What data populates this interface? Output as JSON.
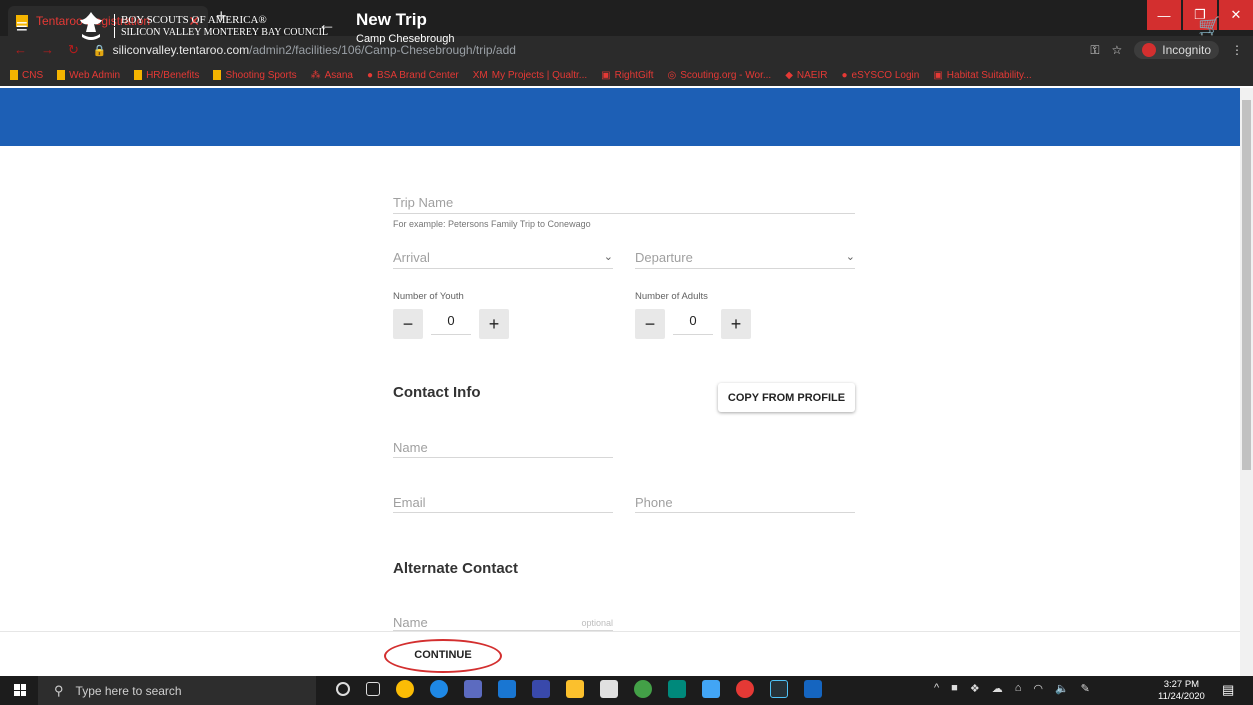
{
  "browser": {
    "tab_title": "Tentaroo Registration",
    "url_host": "siliconvalley.tentaroo.com",
    "url_path": "/admin2/facilities/106/Camp-Chesebrough/trip/add",
    "incognito_label": "Incognito",
    "bookmarks": [
      "CNS",
      "Web Admin",
      "HR/Benefits",
      "Shooting Sports",
      "Asana",
      "BSA Brand Center",
      "My Projects | Qualtr...",
      "RightGift",
      "Scouting.org - Wor...",
      "NAEIR",
      "eSYSCO Login",
      "Habitat Suitability..."
    ]
  },
  "header": {
    "org_line1": "BOY SCOUTS OF AMERICA®",
    "org_line2": "SILICON VALLEY MONTEREY BAY COUNCIL",
    "title": "New Trip",
    "subtitle": "Camp Chesebrough",
    "brand_color": "#1d5fb5"
  },
  "form": {
    "trip_name_placeholder": "Trip Name",
    "trip_name_hint": "For example: Petersons Family Trip to Conewago",
    "arrival_placeholder": "Arrival",
    "departure_placeholder": "Departure",
    "youth_label": "Number of Youth",
    "youth_value": "0",
    "adults_label": "Number of Adults",
    "adults_value": "0",
    "contact_heading": "Contact Info",
    "copy_button": "COPY FROM PROFILE",
    "name_placeholder": "Name",
    "email_placeholder": "Email",
    "phone_placeholder": "Phone",
    "alt_heading": "Alternate Contact",
    "alt_name_placeholder": "Name",
    "alt_optional": "optional",
    "continue_button": "CONTINUE"
  },
  "taskbar": {
    "search_placeholder": "Type here to search",
    "time": "3:27 PM",
    "date": "11/24/2020"
  }
}
